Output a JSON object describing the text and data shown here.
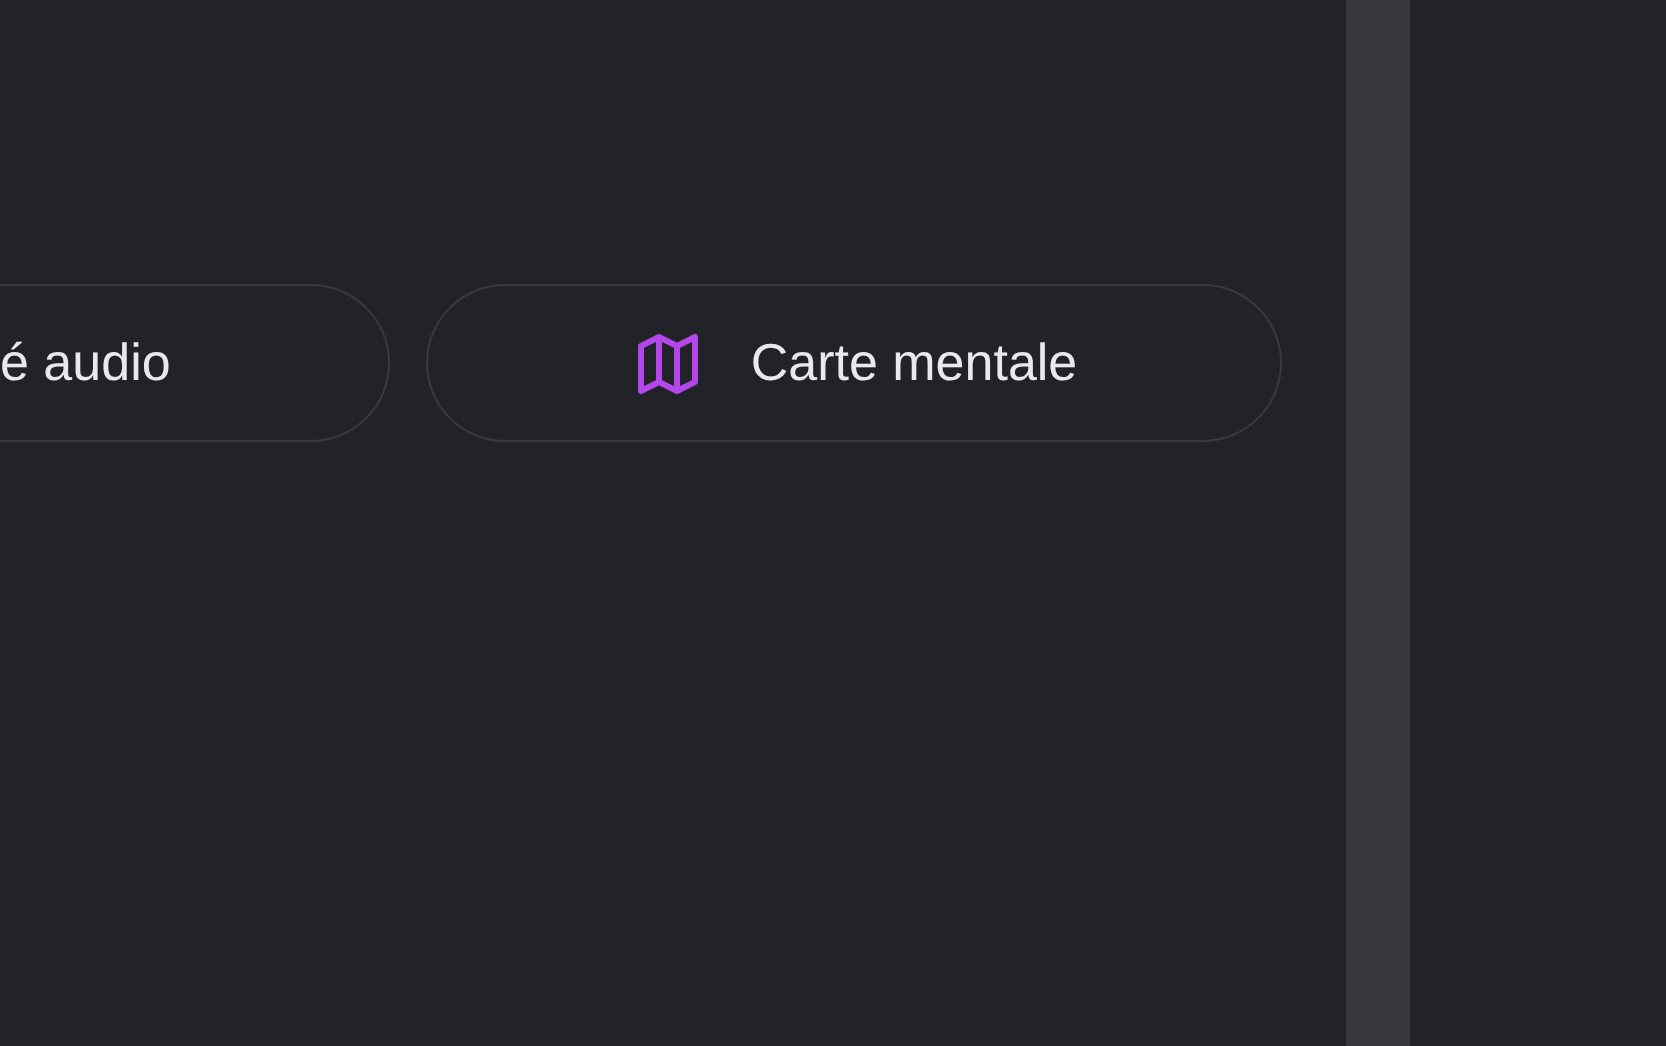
{
  "buttons": [
    {
      "label": "é audio",
      "kind": "cut"
    },
    {
      "label": "Carte mentale",
      "kind": "map"
    }
  ]
}
